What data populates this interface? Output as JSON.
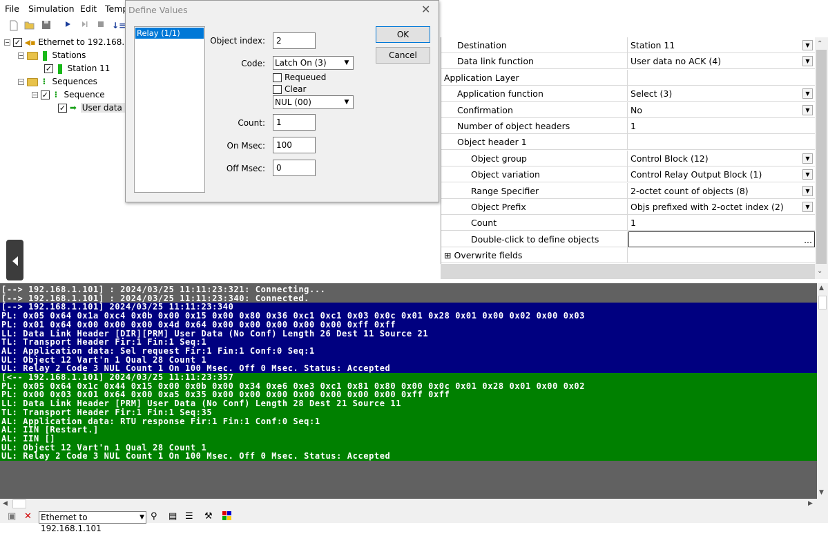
{
  "menu": [
    "File",
    "Simulation",
    "Edit",
    "Temp"
  ],
  "toolbar": {
    "icons": [
      "new-file-icon",
      "open-folder-icon",
      "save-icon",
      "play-icon",
      "step-icon",
      "stop-icon",
      "sort-icon"
    ]
  },
  "tree": {
    "root": "Ethernet to 192.168.1.",
    "stations": "Stations",
    "station11": "Station 11",
    "sequences": "Sequences",
    "sequence": "Sequence",
    "userdata": "User data n"
  },
  "dialog": {
    "title": "Define Values",
    "close": "✕",
    "list_item": "Relay (1/1)",
    "object_index_label": "Object index:",
    "object_index": "2",
    "code_label": "Code:",
    "code_value": "Latch On (3)",
    "requeued_label": "Requeued",
    "clear_label": "Clear",
    "nul_value": "NUL (00)",
    "count_label": "Count:",
    "count": "1",
    "on_msec_label": "On Msec:",
    "on_msec": "100",
    "off_msec_label": "Off Msec:",
    "off_msec": "0",
    "ok": "OK",
    "cancel": "Cancel"
  },
  "props": [
    {
      "name": "Destination",
      "value": "Station 11",
      "indent": 1,
      "dropdown": true
    },
    {
      "name": "Data link function",
      "value": "User data no ACK (4)",
      "indent": 1,
      "dropdown": true
    },
    {
      "name": "Application Layer",
      "value": "",
      "indent": 0,
      "dropdown": false
    },
    {
      "name": "Application function",
      "value": "Select (3)",
      "indent": 1,
      "dropdown": true
    },
    {
      "name": "Confirmation",
      "value": "No",
      "indent": 1,
      "dropdown": true
    },
    {
      "name": "Number of object headers",
      "value": "1",
      "indent": 1,
      "dropdown": false
    },
    {
      "name": "Object header 1",
      "value": "",
      "indent": 1,
      "dropdown": false
    },
    {
      "name": "Object group",
      "value": "Control Block (12)",
      "indent": 2,
      "dropdown": true
    },
    {
      "name": "Object variation",
      "value": "Control Relay Output Block (1)",
      "indent": 2,
      "dropdown": true
    },
    {
      "name": "Range Specifier",
      "value": "2-octet count of objects (8)",
      "indent": 2,
      "dropdown": true
    },
    {
      "name": "Object Prefix",
      "value": "Objs prefixed with 2-octet index (2)",
      "indent": 2,
      "dropdown": true
    },
    {
      "name": "Count",
      "value": "1",
      "indent": 2,
      "dropdown": false
    },
    {
      "name": "Double-click to define objects",
      "value": "",
      "indent": 2,
      "dropdown": false,
      "ellipsis": "..."
    },
    {
      "name": "Overwrite fields",
      "value": "",
      "indent": 0,
      "dropdown": false,
      "expander": "⊞"
    }
  ],
  "log": {
    "gray": [
      "[--> 192.168.1.101] : 2024/03/25 11:11:23:321: Connecting...",
      "[--> 192.168.1.101] : 2024/03/25 11:11:23:340: Connected."
    ],
    "blue": [
      "[--> 192.168.1.101] 2024/03/25 11:11:23:340",
      "PL: 0x05 0x64 0x1a 0xc4 0x0b 0x00 0x15 0x00 0x80 0x36 0xc1 0xc1 0x03 0x0c 0x01 0x28 0x01 0x00 0x02 0x00 0x03",
      "PL: 0x01 0x64 0x00 0x00 0x00 0x4d 0x64 0x00 0x00 0x00 0x00 0x00 0xff 0xff",
      "LL: Data Link Header [DIR][PRM] User Data (No Conf) Length 26 Dest 11 Source 21",
      "TL: Transport Header Fir:1 Fin:1 Seq:1",
      "AL: Application data: Sel request Fir:1 Fin:1 Conf:0 Seq:1",
      "UL: Object 12 Vart'n 1 Qual 28 Count 1",
      "UL: Relay 2 Code 3 NUL Count 1 On 100 Msec. Off 0 Msec. Status: Accepted"
    ],
    "green": [
      "[<-- 192.168.1.101] 2024/03/25 11:11:23:357",
      "PL: 0x05 0x64 0x1c 0x44 0x15 0x00 0x0b 0x00 0x34 0xe6 0xe3 0xc1 0x81 0x80 0x00 0x0c 0x01 0x28 0x01 0x00 0x02",
      "PL: 0x00 0x03 0x01 0x64 0x00 0xa5 0x35 0x00 0x00 0x00 0x00 0x00 0x00 0x00 0xff 0xff",
      "LL: Data Link Header [PRM] User Data (No Conf) Length 28 Dest 21 Source 11",
      "TL: Transport Header Fir:1 Fin:1 Seq:35",
      "AL: Application data: RTU response Fir:1 Fin:1 Conf:0 Seq:1",
      "AL: IIN [Restart.]",
      "AL: IIN []",
      "UL: Object 12 Vart'n 1 Qual 28 Count 1",
      "UL: Relay 2 Code 3 NUL Count 1 On 100 Msec. Off 0 Msec. Status: Accepted"
    ]
  },
  "statusbar": {
    "connection": "Ethernet to 192.168.1.101"
  }
}
